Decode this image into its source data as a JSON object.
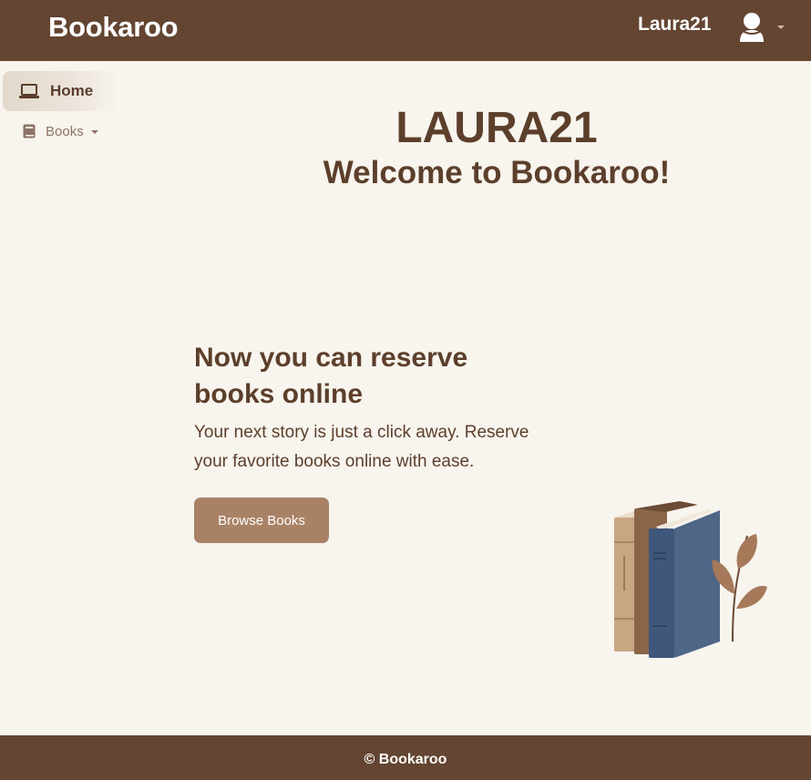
{
  "header": {
    "brand": "Bookaroo",
    "username": "Laura21",
    "icons": {
      "user_menu": "user-avatar-icon",
      "dropdown": "caret-down-icon"
    }
  },
  "sidebar": {
    "items": [
      {
        "label": "Home",
        "icon": "laptop-icon",
        "active": true
      },
      {
        "label": "Books",
        "icon": "book-icon",
        "has_dropdown": true
      }
    ]
  },
  "hero": {
    "title": "LAURA21",
    "subtitle": "Welcome to Bookaroo!"
  },
  "promo": {
    "heading": "Now you can reserve books online",
    "text": "Your next story is just a click away. Reserve your favorite books online with ease.",
    "button_label": "Browse Books",
    "illustration": "books-with-plant-illustration"
  },
  "footer": {
    "text": "© Bookaroo"
  },
  "colors": {
    "header_bg": "#634531",
    "page_bg": "#f8f4ee",
    "text_brown": "#5c3f2b",
    "button_bg": "#a98266"
  }
}
